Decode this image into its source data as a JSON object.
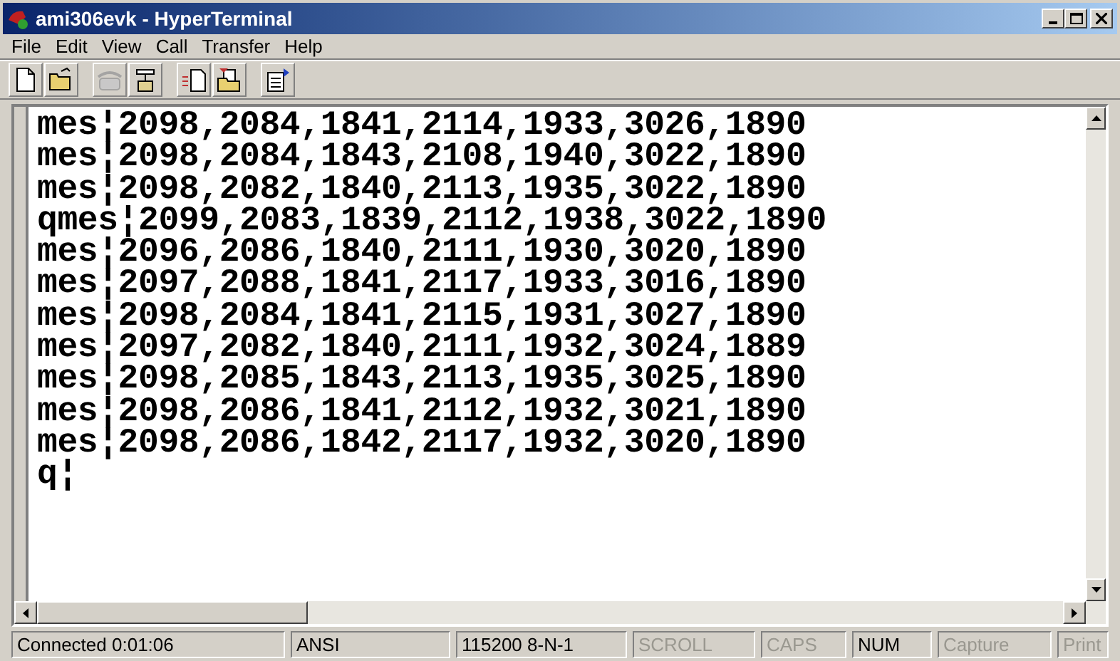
{
  "window": {
    "title": "ami306evk - HyperTerminal"
  },
  "menu": [
    {
      "label": "File"
    },
    {
      "label": "Edit"
    },
    {
      "label": "View"
    },
    {
      "label": "Call"
    },
    {
      "label": "Transfer"
    },
    {
      "label": "Help"
    }
  ],
  "toolbar": [
    {
      "kind": "new",
      "disabled": false
    },
    {
      "kind": "open",
      "disabled": false
    },
    {
      "kind": "disconnect",
      "disabled": true
    },
    {
      "kind": "dial",
      "disabled": false
    },
    {
      "kind": "send",
      "disabled": false
    },
    {
      "kind": "receive",
      "disabled": false
    },
    {
      "kind": "properties",
      "disabled": false
    }
  ],
  "terminal": {
    "lines": [
      "mes¦2098,2084,1841,2114,1933,3026,1890",
      "mes¦2098,2084,1843,2108,1940,3022,1890",
      "mes¦2098,2082,1840,2113,1935,3022,1890",
      "qmes¦2099,2083,1839,2112,1938,3022,1890",
      "mes¦2096,2086,1840,2111,1930,3020,1890",
      "mes¦2097,2088,1841,2117,1933,3016,1890",
      "mes¦2098,2084,1841,2115,1931,3027,1890",
      "mes¦2097,2082,1840,2111,1932,3024,1889",
      "mes¦2098,2085,1843,2113,1935,3025,1890",
      "mes¦2098,2086,1841,2112,1932,3021,1890",
      "mes¦2098,2086,1842,2117,1932,3020,1890",
      "q¦"
    ]
  },
  "status_bar": [
    {
      "text": "Connected 0:01:06",
      "disabled": false
    },
    {
      "text": "ANSI",
      "disabled": false
    },
    {
      "text": "115200 8-N-1",
      "disabled": false
    },
    {
      "text": "SCROLL",
      "disabled": true
    },
    {
      "text": "CAPS",
      "disabled": true
    },
    {
      "text": "NUM",
      "disabled": false
    },
    {
      "text": "Capture",
      "disabled": true
    },
    {
      "text": "Print",
      "disabled": true
    }
  ]
}
